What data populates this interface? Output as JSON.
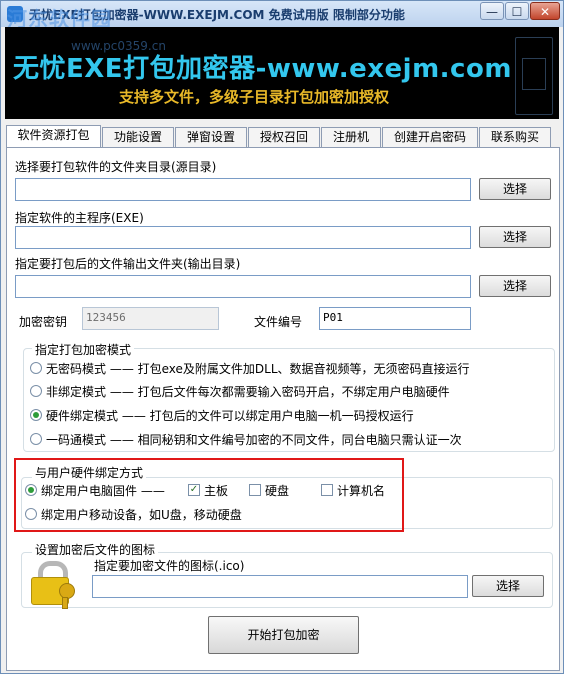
{
  "window": {
    "title": "无忧EXE打包加密器-WWW.EXEJM.COM  免费试用版  限制部分功能",
    "watermark_logo": "河东软件园",
    "watermark_url": "www.pc0359.cn",
    "min_label": "—",
    "max_label": "☐",
    "close_label": "✕"
  },
  "banner": {
    "title": "无忧EXE打包加密器-www.exejm.com",
    "subtitle": "支持多文件，多级子目录打包加密加授权"
  },
  "tabs": [
    {
      "label": "软件资源打包"
    },
    {
      "label": "功能设置"
    },
    {
      "label": "弹窗设置"
    },
    {
      "label": "授权召回"
    },
    {
      "label": "注册机"
    },
    {
      "label": "创建开启密码"
    },
    {
      "label": "联系购买"
    }
  ],
  "source": {
    "label": "选择要打包软件的文件夹目录(源目录)",
    "value": "",
    "button": "选择"
  },
  "main_exe": {
    "label": "指定软件的主程序(EXE)",
    "value": "",
    "button": "选择"
  },
  "output": {
    "label": "指定要打包后的文件输出文件夹(输出目录)",
    "value": "",
    "button": "选择"
  },
  "key": {
    "label": "加密密钥",
    "value": "123456"
  },
  "file_no": {
    "label": "文件编号",
    "value": "P01"
  },
  "mode_group": {
    "title": "指定打包加密模式",
    "options": [
      {
        "label": "无密码模式 —— 打包exe及附属文件加DLL、数据音视频等，无须密码直接运行",
        "selected": false
      },
      {
        "label": "非绑定模式 —— 打包后文件每次都需要输入密码开启，不绑定用户电脑硬件",
        "selected": false
      },
      {
        "label": "硬件绑定模式 —— 打包后的文件可以绑定用户电脑一机一码授权运行",
        "selected": true
      },
      {
        "label": "一码通模式 —— 相同秘钥和文件编号加密的不同文件，同台电脑只需认证一次",
        "selected": false
      }
    ]
  },
  "bind_group": {
    "title": "与用户硬件绑定方式",
    "option_pc": "绑定用户电脑固件 ——",
    "option_pc_selected": true,
    "mainboard": "主板",
    "mainboard_checked": true,
    "disk": "硬盘",
    "disk_checked": false,
    "pcname": "计算机名",
    "pcname_checked": false,
    "option_mobile": "绑定用户移动设备，如U盘，移动硬盘",
    "option_mobile_selected": false
  },
  "icon_group": {
    "title": "设置加密后文件的图标",
    "label": "指定要加密文件的图标(.ico)",
    "value": "",
    "button": "选择"
  },
  "start_button": "开始打包加密",
  "colors": {
    "banner_bg": "#000000",
    "banner_title": "#33c7ee",
    "banner_sub": "#e8b828",
    "highlight": "#e01818",
    "radio_on": "#2e9c3a"
  }
}
